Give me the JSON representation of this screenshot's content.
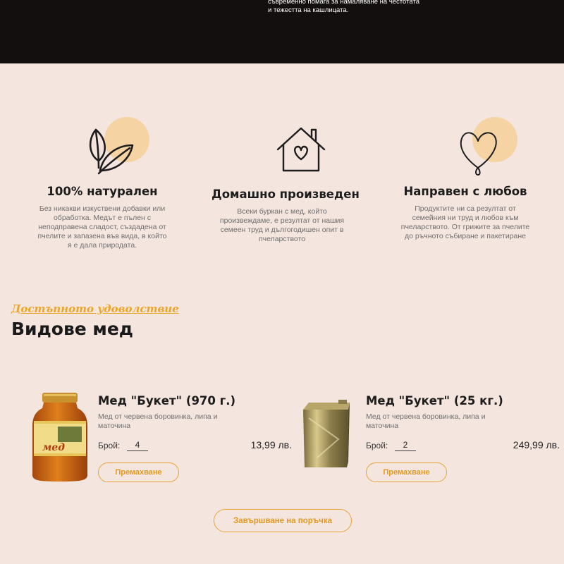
{
  "hero": {
    "text": "съвременно помага за намаляване на честотата и тежестта на кашлицата."
  },
  "features": [
    {
      "icon": "leaf-icon",
      "title": "100% натурален",
      "text": "Без никакви изкуствени добавки или обработка. Медът е пълен с неподправена сладост, създадена от пчелите и запазена във вида, в който я е дала природата."
    },
    {
      "icon": "house-heart-icon",
      "title": "Домашно произведен",
      "text": "Всеки буркан с мед, който произвеждаме, е резултат от нашия семеен труд и дългогодишен опит в пчеларството"
    },
    {
      "icon": "heart-icon",
      "title": "Направен с любов",
      "text": "Продуктите ни са резултат от семейния ни труд и любов към пчеларството. От грижите за пчелите до ръчното събиране и пакетиране"
    }
  ],
  "section": {
    "subheading": "Достъпното удоволствие",
    "heading": "Видове мед"
  },
  "products": [
    {
      "image": "honey-jar-image",
      "jar_label": "мед",
      "title": "Мед \"Букет\" (970 г.)",
      "description": "Мед от червена боровинка, липа и маточина",
      "qty_label": "Брой:",
      "qty": "4",
      "price": "13,99 лв.",
      "remove_label": "Премахване"
    },
    {
      "image": "honey-tin-image",
      "title": "Мед \"Букет\" (25 кг.)",
      "description": "Мед от червена боровинка, липа и маточина",
      "qty_label": "Брой:",
      "qty": "2",
      "price": "249,99 лв.",
      "remove_label": "Премахване"
    }
  ],
  "checkout": {
    "label": "Завършване на поръчка"
  },
  "colors": {
    "background": "#f4e5de",
    "topbar": "#140f0f",
    "accent": "#e7a43a",
    "icon_circle": "#f6d3a3"
  }
}
